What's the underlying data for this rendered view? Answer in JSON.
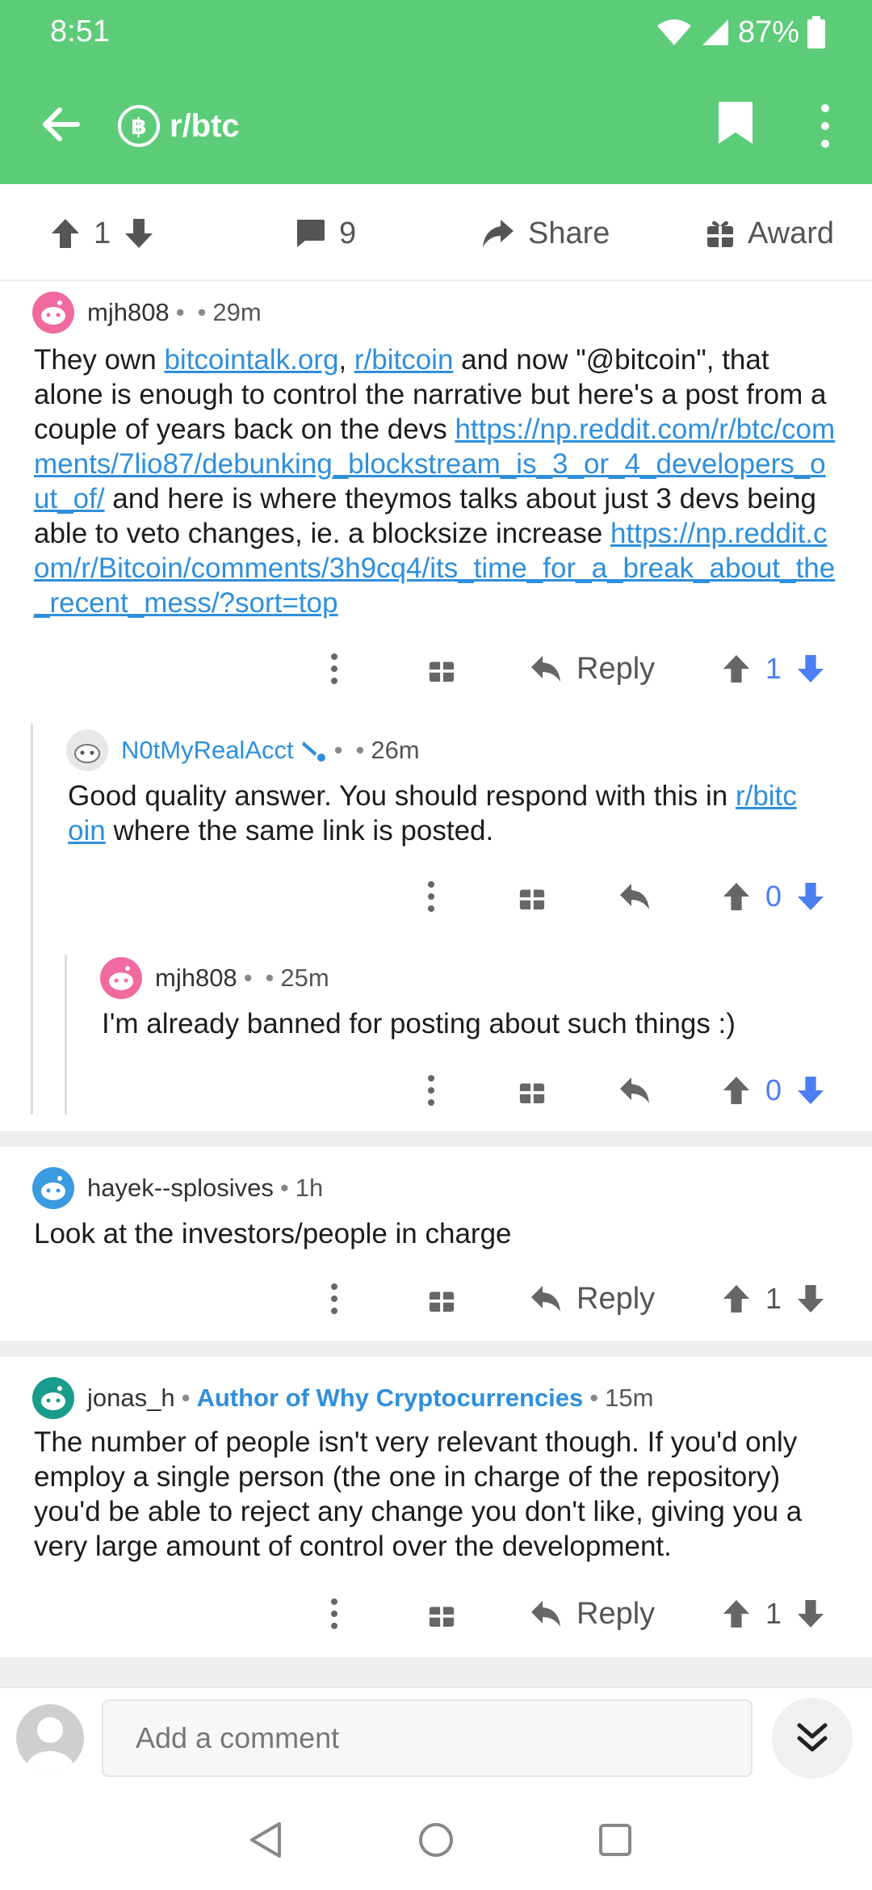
{
  "status_bar": {
    "time": "8:51",
    "battery": "87%"
  },
  "app_bar": {
    "subreddit": "r/btc",
    "sub_icon_glyph": "฿"
  },
  "post_actions": {
    "upvotes": "1",
    "comments": "9",
    "share_label": "Share",
    "award_label": "Award"
  },
  "comments": [
    {
      "author": "mjh808",
      "time": "29m",
      "segments": [
        {
          "t": "They own "
        },
        {
          "link": "bitcointalk.org"
        },
        {
          "t": ", "
        },
        {
          "link": "r/bitcoin"
        },
        {
          "t": " and now \"@bitcoin\", that alone is enough to control the narrative but here's a post from a couple of years back on the devs "
        },
        {
          "link": "https://np.reddit.com/r/btc/comments/7lio87/debunking_blockstream_is_3_or_4_developers_out_of/"
        },
        {
          "t": " and here is where theymos talks about just 3 devs being able to veto changes, ie. a blocksize increase "
        },
        {
          "link": "https://np.reddit.com/r/Bitcoin/comments/3h9cq4/its_time_for_a_break_about_the_recent_mess/?sort=top"
        }
      ],
      "reply_label": "Reply",
      "score": "1"
    },
    {
      "author": "N0tMyRealAcct",
      "time": "26m",
      "segments": [
        {
          "t": "Good quality answer. You should respond with this in "
        },
        {
          "link": "r/bitcoin"
        },
        {
          "t": " where the same link is posted."
        }
      ],
      "score": "0"
    },
    {
      "author": "mjh808",
      "time": "25m",
      "segments": [
        {
          "t": "I'm already banned for posting about such things :)"
        }
      ],
      "score": "0"
    },
    {
      "author": "hayek--splosives",
      "time": "1h",
      "segments": [
        {
          "t": "Look at the investors/people in charge"
        }
      ],
      "reply_label": "Reply",
      "score": "1"
    },
    {
      "author": "jonas_h",
      "flair": "Author of Why Cryptocurrencies",
      "time": "15m",
      "segments": [
        {
          "t": "The number of people isn't very relevant though. If you'd only employ a single person (the one in charge of the repository) you'd be able to reject any change you don't like, giving you a very large amount of control over the development."
        }
      ],
      "reply_label": "Reply",
      "score": "1"
    }
  ],
  "composer": {
    "placeholder": "Add a comment"
  },
  "colors": {
    "brand_green": "#5ccc78",
    "link_blue": "#2f8fdb",
    "vote_blue": "#4b7ef0"
  }
}
